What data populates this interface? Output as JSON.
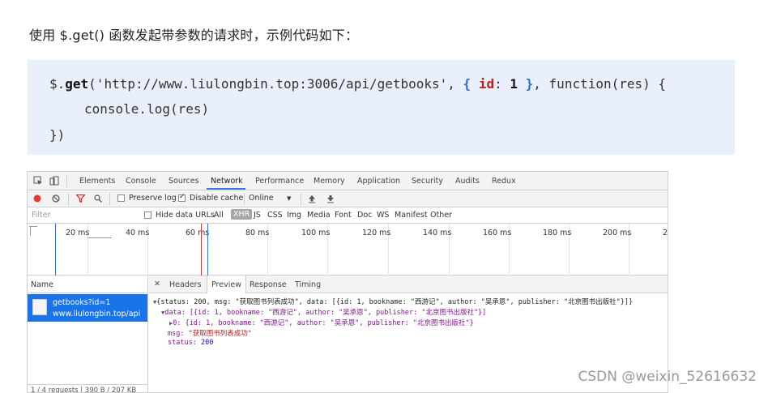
{
  "intro_text": "使用 $.get() 函数发起带参数的请求时，示例代码如下：",
  "code": {
    "line1_prefix": "$.",
    "line1_get": "get",
    "line1_mid": "('http://www.liulongbin.top:3006/api/getbooks', ",
    "line1_brace_open": "{",
    "line1_key": "id",
    "line1_colon": ": ",
    "line1_num": "1",
    "line1_brace_close": "}",
    "line1_suffix": ", function(res) {",
    "line2": "console.log(res)",
    "line3": "})"
  },
  "devtools": {
    "tabs": [
      "Elements",
      "Console",
      "Sources",
      "Network",
      "Performance",
      "Memory",
      "Application",
      "Security",
      "Audits",
      "Redux"
    ],
    "active_tab": "Network",
    "toolbar": {
      "preserve_log": "Preserve log",
      "disable_cache": "Disable cache",
      "throttle": "Online",
      "throttle_arrow": "▼"
    },
    "filter": {
      "placeholder": "Filter",
      "hide_data_urls": "Hide data URLs",
      "types": [
        "All",
        "XHR",
        "JS",
        "CSS",
        "Img",
        "Media",
        "Font",
        "Doc",
        "WS",
        "Manifest",
        "Other"
      ],
      "active_type": "XHR"
    },
    "timeline_ticks": [
      "20 ms",
      "40 ms",
      "60 ms",
      "80 ms",
      "100 ms",
      "120 ms",
      "140 ms",
      "160 ms",
      "180 ms",
      "200 ms",
      "2:"
    ],
    "name_header": "Name",
    "request": {
      "name": "getbooks?id=1",
      "host": "www.liulongbin.top/api"
    },
    "footer": "1 / 4 requests  |  390 B / 207 KB",
    "detail_tabs": [
      "Headers",
      "Preview",
      "Response",
      "Timing"
    ],
    "active_detail_tab": "Preview",
    "preview": {
      "line1": "{status: 200, msg: \"获取图书列表成功\", data: [{id: 1, bookname: \"西游记\", author: \"吴承恩\", publisher: \"北京图书出版社\"}]}",
      "line2": "data: [{id: 1, bookname: \"西游记\", author: \"吴承恩\", publisher: \"北京图书出版社\"}]",
      "line3": "0: {id: 1, bookname: \"西游记\", author: \"吴承恩\", publisher: \"北京图书出版社\"}",
      "msg_key": "msg: ",
      "msg_val": "\"获取图书列表成功\"",
      "status_key": "status: ",
      "status_val": "200"
    }
  },
  "watermark": "CSDN @weixin_52616632"
}
